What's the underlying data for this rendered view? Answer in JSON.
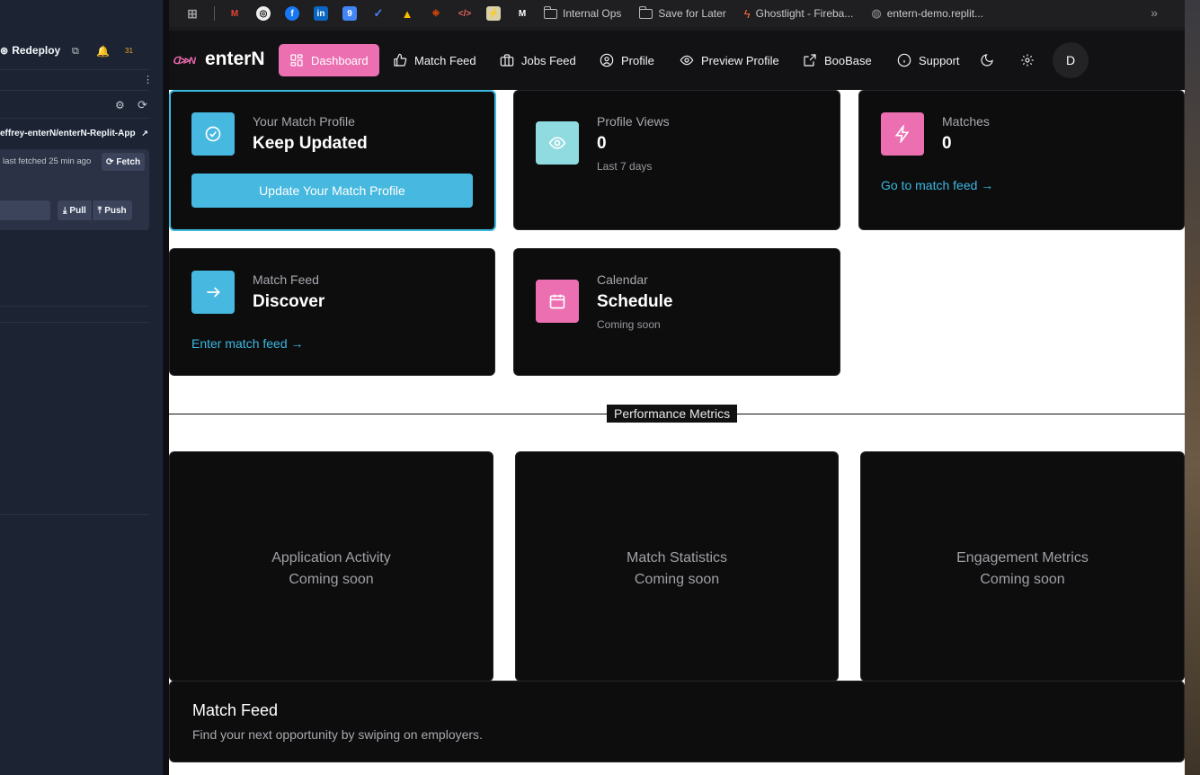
{
  "left_panel": {
    "redeploy_label": "Redeploy",
    "badge": "31",
    "repo": "effrey-enterN/enterN-Replit-App",
    "fetched_text": "last fetched 25 min ago",
    "fetch_label": "Fetch",
    "pull_label": "Pull",
    "push_label": "Push"
  },
  "bookmarks": {
    "folders": [
      "Internal Ops",
      "Save for Later"
    ],
    "items": [
      "Ghostlight - Fireba...",
      "entern-demo.replit..."
    ]
  },
  "nav": {
    "logo": "enterN",
    "items": [
      "Dashboard",
      "Match Feed",
      "Jobs Feed",
      "Profile",
      "Preview Profile",
      "BooBase",
      "Support"
    ],
    "avatar": "D"
  },
  "cards": {
    "match_profile": {
      "label": "Your Match Profile",
      "value": "Keep Updated",
      "button": "Update Your Match Profile"
    },
    "profile_views": {
      "label": "Profile Views",
      "value": "0",
      "sub": "Last 7 days"
    },
    "matches": {
      "label": "Matches",
      "value": "0",
      "link": "Go to match feed →"
    },
    "match_feed": {
      "label": "Match Feed",
      "value": "Discover",
      "link": "Enter match feed →"
    },
    "calendar": {
      "label": "Calendar",
      "value": "Schedule",
      "sub": "Coming soon"
    }
  },
  "metrics": {
    "title": "Performance Metrics",
    "items": [
      {
        "name": "Application Activity",
        "status": "Coming soon"
      },
      {
        "name": "Match Statistics",
        "status": "Coming soon"
      },
      {
        "name": "Engagement Metrics",
        "status": "Coming soon"
      }
    ]
  },
  "feed_section": {
    "title": "Match Feed",
    "subtitle": "Find your next opportunity by swiping on employers."
  },
  "colors": {
    "accent_pink": "#ec6fb2",
    "accent_blue": "#47b8df",
    "accent_cyan": "#8fdbe0"
  }
}
